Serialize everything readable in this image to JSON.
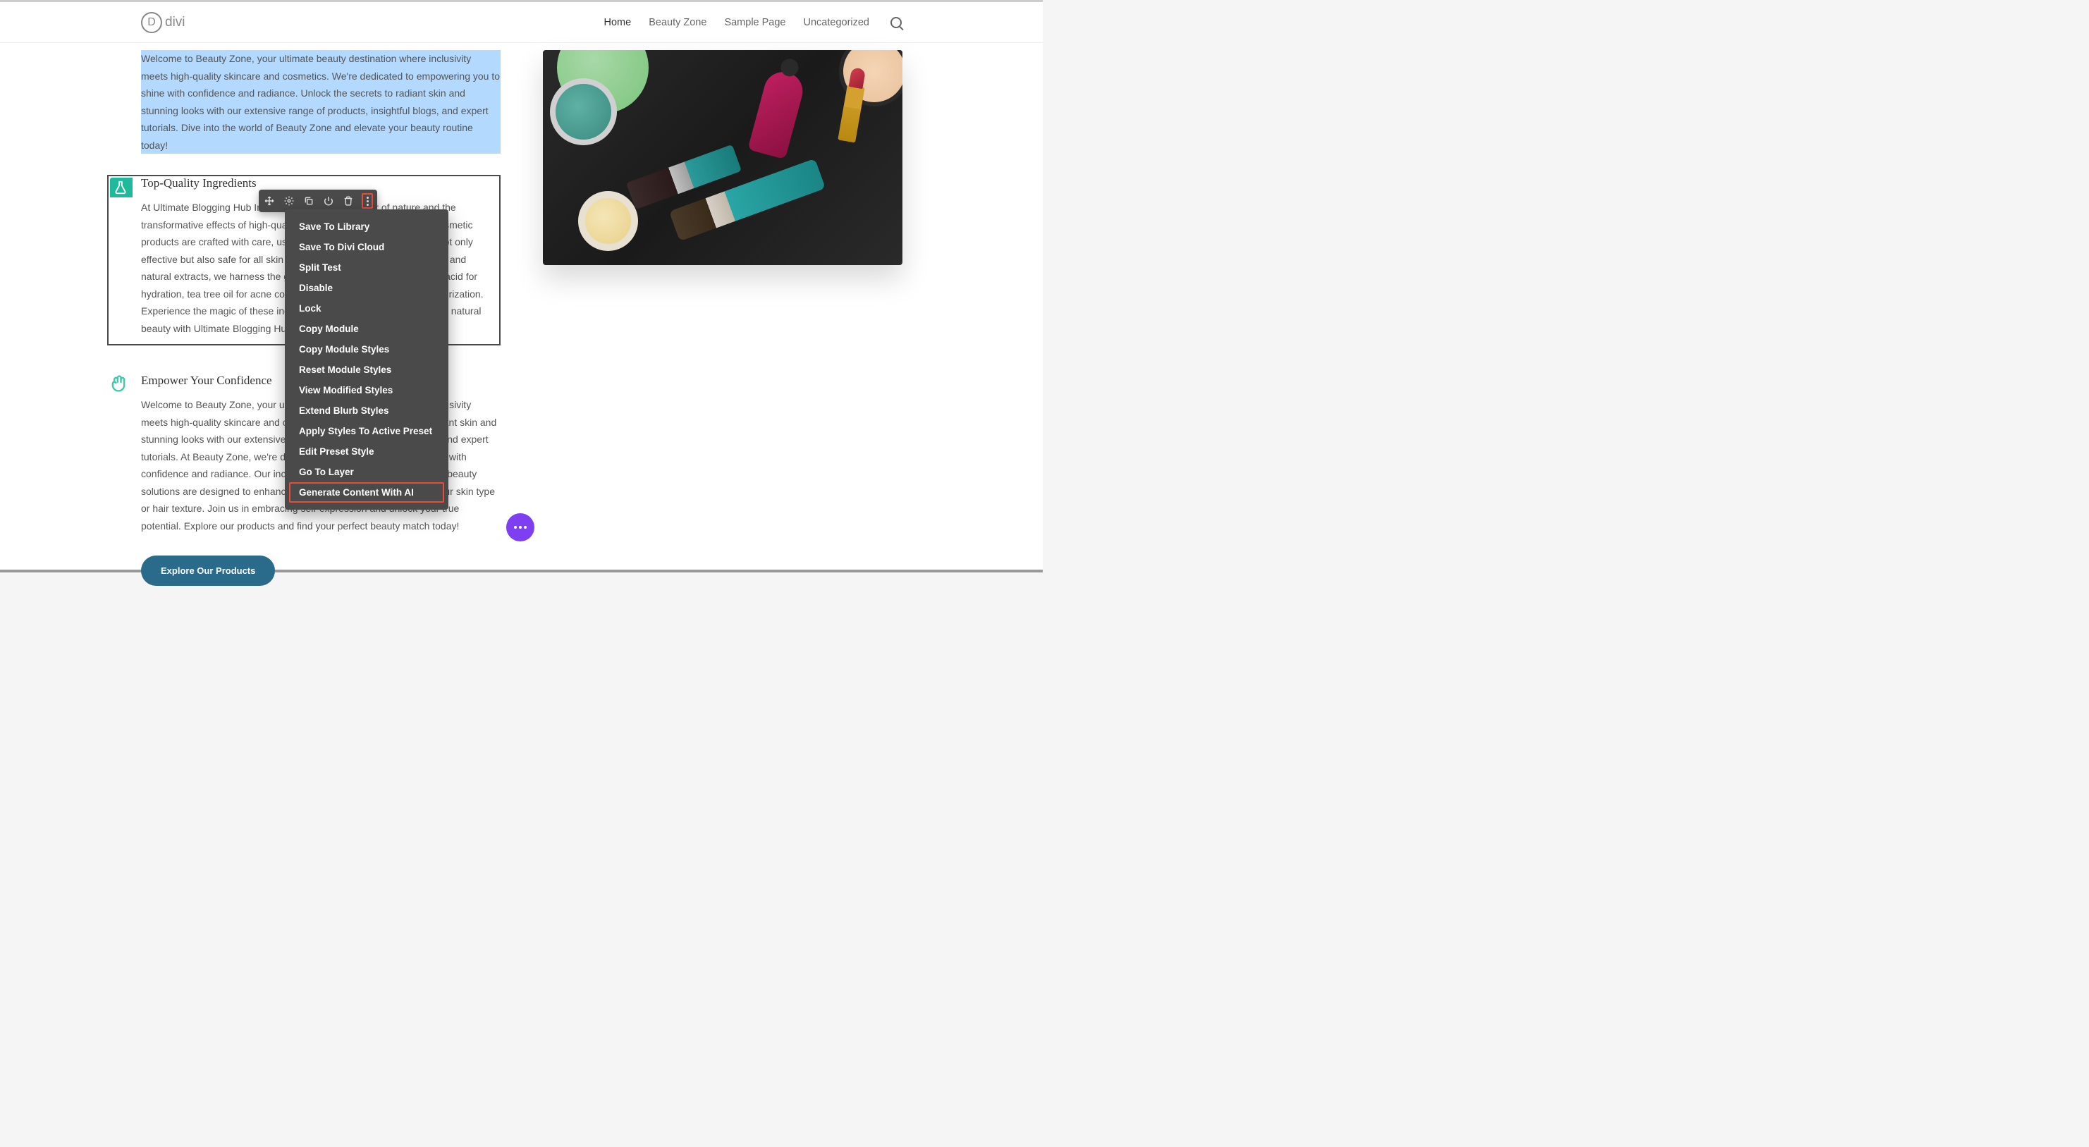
{
  "header": {
    "logo_letter": "D",
    "logo_text": "divi",
    "nav": [
      "Home",
      "Beauty Zone",
      "Sample Page",
      "Uncategorized"
    ]
  },
  "intro_text": "Welcome to Beauty Zone, your ultimate beauty destination where inclusivity meets high-quality skincare and cosmetics. We're dedicated to empowering you to shine with confidence and radiance. Unlock the secrets to radiant skin and stunning looks with our extensive range of products, insightful blogs, and expert tutorials. Dive into the world of Beauty Zone and elevate your beauty routine today!",
  "blurb1": {
    "title": "Top-Quality Ingredients",
    "text": "At Ultimate Blogging Hub Inc., we believe in the power of nature and the transformative effects of high-quality ingredients. Our skincare and cosmetic products are crafted with care, using the finest components that are not only effective but also safe for all skin types. From vitamin-rich antioxidants and natural extracts, we harness the goodness of nature: think hyaluronic acid for hydration, tea tree oil for acne control, and shea butter for deep moisturization. Experience the magic of these ingredients in every jar and unlock your natural beauty with Ultimate Blogging Hub Inc."
  },
  "blurb2": {
    "title": "Empower Your Confidence",
    "text": "Welcome to Beauty Zone, your ultimate beauty destination where inclusivity meets high-quality skincare and cosmetics. Unlock the secrets to radiant skin and stunning looks with our extensive range of products, insightful blogs, and expert tutorials. At Beauty Zone, we're dedicated to empowering you to shine with confidence and radiance. Our inclusive community celebrates diverse beauty solutions are designed to enhance your unique features, no matter your skin type or hair texture. Join us in embracing self-expression and unlock your true potential. Explore our products and find your perfect beauty match today!"
  },
  "cta": {
    "label": "Explore Our Products"
  },
  "toolbar": {
    "icons": [
      "move-icon",
      "gear-icon",
      "duplicate-icon",
      "power-icon",
      "trash-icon",
      "more-icon"
    ]
  },
  "context_menu": {
    "items": [
      "Save To Library",
      "Save To Divi Cloud",
      "Split Test",
      "Disable",
      "Lock",
      "Copy Module",
      "Copy Module Styles",
      "Reset Module Styles",
      "View Modified Styles",
      "Extend Blurb Styles",
      "Apply Styles To Active Preset",
      "Edit Preset Style",
      "Go To Layer",
      "Generate Content With AI"
    ]
  }
}
